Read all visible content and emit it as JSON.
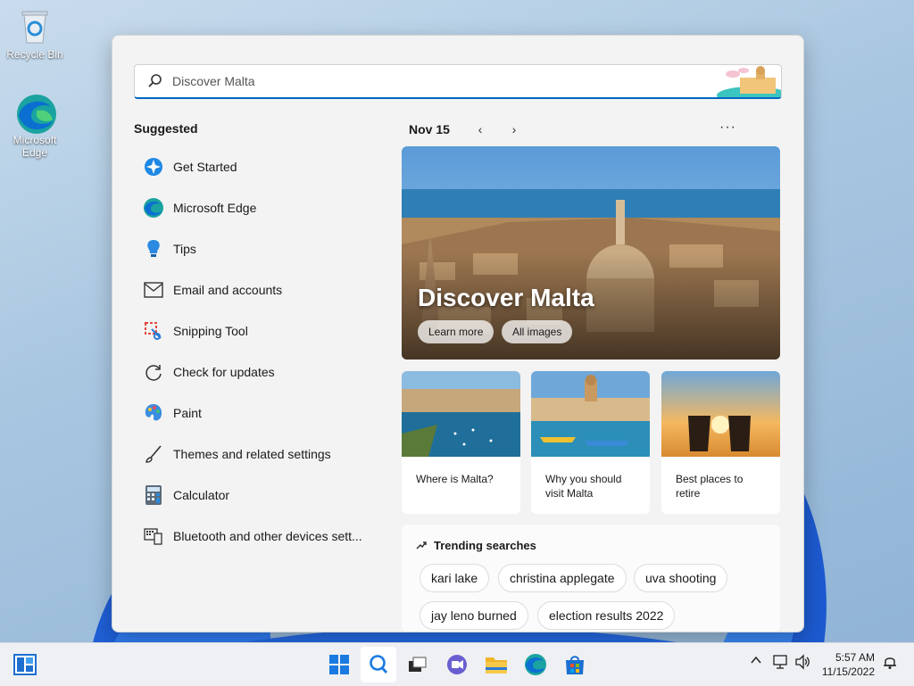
{
  "desktop": {
    "icons": [
      {
        "label": "Recycle Bin"
      },
      {
        "label": "Microsoft Edge"
      }
    ]
  },
  "search": {
    "placeholder": "Discover Malta"
  },
  "suggested": {
    "title": "Suggested",
    "items": [
      {
        "label": "Get Started",
        "icon": "get-started-icon"
      },
      {
        "label": "Microsoft Edge",
        "icon": "edge-icon"
      },
      {
        "label": "Tips",
        "icon": "tips-icon"
      },
      {
        "label": "Email and accounts",
        "icon": "mail-icon"
      },
      {
        "label": "Snipping Tool",
        "icon": "snipping-tool-icon"
      },
      {
        "label": "Check for updates",
        "icon": "refresh-icon"
      },
      {
        "label": "Paint",
        "icon": "paint-icon"
      },
      {
        "label": "Themes and related settings",
        "icon": "brush-icon"
      },
      {
        "label": "Calculator",
        "icon": "calculator-icon"
      },
      {
        "label": "Bluetooth and other devices sett...",
        "icon": "devices-icon"
      }
    ]
  },
  "highlights": {
    "date": "Nov 15",
    "prev": "‹",
    "next": "›",
    "more": "···",
    "hero": {
      "title": "Discover Malta",
      "learn_more": "Learn more",
      "all_images": "All images"
    },
    "cards": [
      {
        "text": "Where is Malta?"
      },
      {
        "text": "Why you should visit Malta"
      },
      {
        "text": "Best places to retire"
      }
    ],
    "trending": {
      "title": "Trending searches",
      "pills": [
        "kari lake",
        "christina applegate",
        "uva shooting",
        "jay leno burned",
        "election results 2022"
      ]
    }
  },
  "taskbar": {
    "time": "5:57 AM",
    "date": "11/15/2022"
  }
}
